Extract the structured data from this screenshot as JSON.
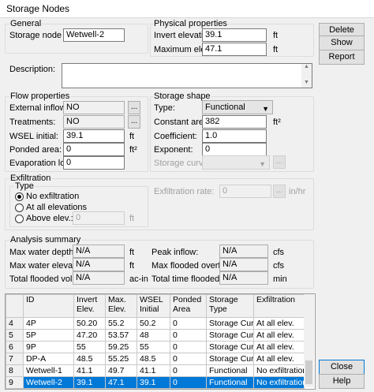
{
  "title": "Storage Nodes",
  "general": {
    "title": "General",
    "node_id_label": "Storage node ID:",
    "node_id_value": "Wetwell-2",
    "description_label": "Description:",
    "description_value": ""
  },
  "physical": {
    "title": "Physical properties",
    "invert_label": "Invert elevation:",
    "invert_value": "39.1",
    "invert_unit": "ft",
    "maxelev_label": "Maximum elev.:",
    "maxelev_value": "47.1",
    "maxelev_unit": "ft"
  },
  "buttons": {
    "delete": "Delete",
    "show": "Show",
    "report": "Report",
    "close": "Close",
    "help": "Help",
    "dots": "..."
  },
  "flow": {
    "title": "Flow properties",
    "ext_label": "External inflows:",
    "ext_value": "NO",
    "treat_label": "Treatments:",
    "treat_value": "NO",
    "wsel_label": "WSEL initial:",
    "wsel_value": "39.1",
    "wsel_unit": "ft",
    "ponded_label": "Ponded area:",
    "ponded_value": "0",
    "ponded_unit": "ft²",
    "evap_label": "Evaporation loss:",
    "evap_value": "0"
  },
  "shape": {
    "title": "Storage shape",
    "type_label": "Type:",
    "type_value": "Functional",
    "const_label": "Constant area:",
    "const_value": "382",
    "const_unit": "ft²",
    "coef_label": "Coefficient:",
    "coef_value": "1.0",
    "exp_label": "Exponent:",
    "exp_value": "0",
    "curve_label": "Storage curve:",
    "curve_value": ""
  },
  "exfil": {
    "title": "Exfiltration",
    "type_title": "Type",
    "opt_none": "No exfiltration",
    "opt_all": "At all elevations",
    "opt_above": "Above elev.:",
    "above_value": "0",
    "above_unit": "ft",
    "rate_label": "Exfiltration rate:",
    "rate_value": "0",
    "rate_unit": "in/hr"
  },
  "analysis": {
    "title": "Analysis summary",
    "mwd_label": "Max water depth:",
    "mwd_value": "N/A",
    "mwd_unit": "ft",
    "mwe_label": "Max water elevation:",
    "mwe_value": "N/A",
    "mwe_unit": "ft",
    "tfv_label": "Total flooded vol.:",
    "tfv_value": "N/A",
    "tfv_unit": "ac-in",
    "pi_label": "Peak inflow:",
    "pi_value": "N/A",
    "pi_unit": "cfs",
    "mfo_label": "Max flooded overflow:",
    "mfo_value": "N/A",
    "mfo_unit": "cfs",
    "ttf_label": "Total time flooded:",
    "ttf_value": "N/A",
    "ttf_unit": "min"
  },
  "table": {
    "headers": [
      "",
      "ID",
      "Invert\nElev.",
      "Max.\nElev.",
      "WSEL\nInitial",
      "Ponded\nArea",
      "Storage\nType",
      "Exfiltration"
    ],
    "rows": [
      [
        "4",
        "4P",
        "50.20",
        "55.2",
        "50.2",
        "0",
        "Storage Curve",
        "At all elev."
      ],
      [
        "5",
        "5P",
        "47.20",
        "53.57",
        "48",
        "0",
        "Storage Curve",
        "At all elev."
      ],
      [
        "6",
        "9P",
        "55",
        "59.25",
        "55",
        "0",
        "Storage Curve",
        "At all elev."
      ],
      [
        "7",
        "DP-A",
        "48.5",
        "55.25",
        "48.5",
        "0",
        "Storage Curve",
        "At all elev."
      ],
      [
        "8",
        "Wetwell-1",
        "41.1",
        "49.7",
        "41.1",
        "0",
        "Functional",
        "No exfiltration"
      ],
      [
        "9",
        "Wetwell-2",
        "39.1",
        "47.1",
        "39.1",
        "0",
        "Functional",
        "No exfiltration"
      ]
    ],
    "selected_row": 5
  }
}
